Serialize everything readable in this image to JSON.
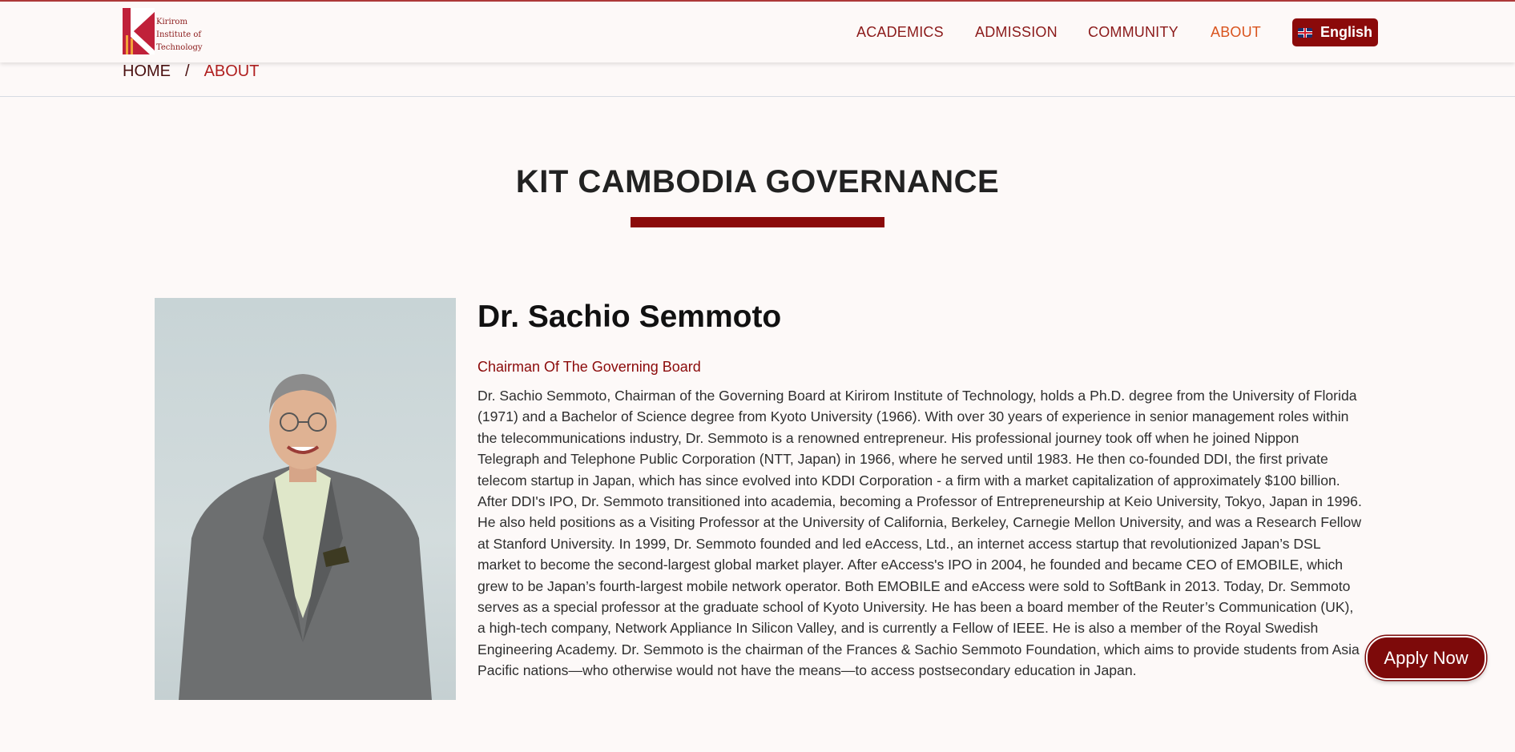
{
  "header": {
    "logo_text": [
      "Kirirom",
      "Institute of",
      "Technology"
    ],
    "nav": [
      {
        "label": "ACADEMICS",
        "active": false
      },
      {
        "label": "ADMISSION",
        "active": false
      },
      {
        "label": "COMMUNITY",
        "active": false
      },
      {
        "label": "ABOUT",
        "active": true
      }
    ],
    "language_button": "English",
    "flag_icon": "uk-flag-icon"
  },
  "breadcrumb": {
    "home": "HOME",
    "separator": "/",
    "current": "ABOUT"
  },
  "page_title": "KIT CAMBODIA GOVERNANCE",
  "profile": {
    "name": "Dr. Sachio Semmoto",
    "role": "Chairman Of The Governing Board",
    "bio": "Dr. Sachio Semmoto, Chairman of the Governing Board at Kirirom Institute of Technology, holds a Ph.D. degree from the University of Florida (1971) and a Bachelor of Science degree from Kyoto University (1966). With over 30 years of experience in senior management roles within the telecommunications industry, Dr. Semmoto is a renowned entrepreneur. His professional journey took off when he joined Nippon Telegraph and Telephone Public Corporation (NTT, Japan) in 1966, where he served until 1983. He then co-founded DDI, the first private telecom startup in Japan, which has since evolved into KDDI Corporation - a firm with a market capitalization of approximately $100 billion. After DDI's IPO, Dr. Semmoto transitioned into academia, becoming a Professor of Entrepreneurship at Keio University, Tokyo, Japan in 1996. He also held positions as a Visiting Professor at the University of California, Berkeley, Carnegie Mellon University, and was a Research Fellow at Stanford University. In 1999, Dr. Semmoto founded and led eAccess, Ltd., an internet access startup that revolutionized Japan’s DSL market to become the second-largest global market player. After eAccess's IPO in 2004, he founded and became CEO of EMOBILE, which grew to be Japan’s fourth-largest mobile network operator. Both EMOBILE and eAccess were sold to SoftBank in 2013. Today, Dr. Semmoto serves as a special professor at the graduate school of Kyoto University. He has been a board member of the Reuter’s Communication (UK), a high-tech company, Network Appliance In Silicon Valley, and is currently a Fellow of IEEE. He is also a member of the Royal Swedish Engineering Academy. Dr. Semmoto is the chairman of the Frances & Sachio Semmoto Foundation, which aims to provide students from Asia Pacific nations—who otherwise would not have the means—to access postsecondary education in Japan."
  },
  "apply_button": "Apply Now",
  "colors": {
    "brand": "#8b0a0a",
    "active_nav": "#d9541e",
    "background": "#fdf9f8"
  }
}
